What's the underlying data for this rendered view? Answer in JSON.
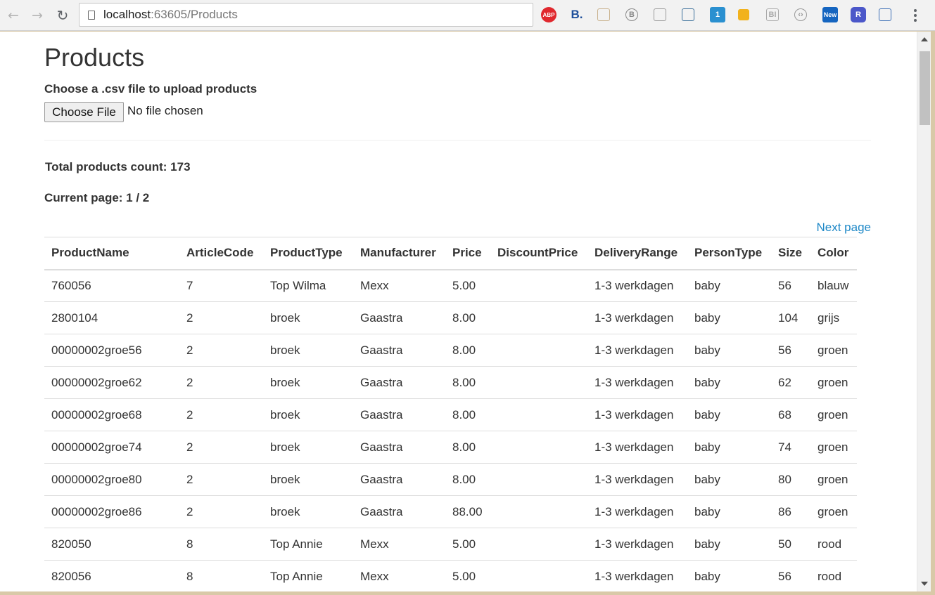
{
  "browser": {
    "url_host": "localhost",
    "url_rest": ":63605/Products",
    "extensions": [
      {
        "name": "adblock-plus-icon",
        "text": "ABP",
        "color": "#e0282e"
      },
      {
        "name": "b-extension-icon",
        "text": "B.",
        "color": "#1d4f9b"
      },
      {
        "name": "avatar-extension-icon",
        "text": "",
        "color": "#c8b08a"
      },
      {
        "name": "circle-b-extension-icon",
        "text": "B",
        "color": "#888888"
      },
      {
        "name": "document-extension-icon",
        "text": "",
        "color": "#9a9a9a"
      },
      {
        "name": "bug-extension-icon",
        "text": "",
        "color": "#3a6f9a"
      },
      {
        "name": "camera-extension-icon",
        "text": "1",
        "color": "#2a90d0"
      },
      {
        "name": "puzzle-extension-icon",
        "text": "",
        "color": "#f2b21c"
      },
      {
        "name": "bi-extension-icon",
        "text": "BI",
        "color": "#aaaaaa"
      },
      {
        "name": "code-extension-icon",
        "text": "‹›",
        "color": "#999999"
      },
      {
        "name": "new-extension-icon",
        "text": "New",
        "color": "#1565c0"
      },
      {
        "name": "r-extension-icon",
        "text": "R",
        "color": "#4b57c9"
      },
      {
        "name": "dots-extension-icon",
        "text": "",
        "color": "#3d6fb6"
      }
    ]
  },
  "page": {
    "title": "Products",
    "upload_label": "Choose a .csv file to upload products",
    "choose_file_button": "Choose File",
    "no_file_text": "No file chosen",
    "total_count": "Total products count: 173",
    "current_page": "Current page: 1 / 2",
    "next_page_link": "Next page"
  },
  "table": {
    "headers": [
      "ProductName",
      "ArticleCode",
      "ProductType",
      "Manufacturer",
      "Price",
      "DiscountPrice",
      "DeliveryRange",
      "PersonType",
      "Size",
      "Color"
    ],
    "rows": [
      [
        "760056",
        "7",
        "Top Wilma",
        "Mexx",
        "5.00",
        "",
        "1-3 werkdagen",
        "baby",
        "56",
        "blauw"
      ],
      [
        "2800104",
        "2",
        "broek",
        "Gaastra",
        "8.00",
        "",
        "1-3 werkdagen",
        "baby",
        "104",
        "grijs"
      ],
      [
        "00000002groe56",
        "2",
        "broek",
        "Gaastra",
        "8.00",
        "",
        "1-3 werkdagen",
        "baby",
        "56",
        "groen"
      ],
      [
        "00000002groe62",
        "2",
        "broek",
        "Gaastra",
        "8.00",
        "",
        "1-3 werkdagen",
        "baby",
        "62",
        "groen"
      ],
      [
        "00000002groe68",
        "2",
        "broek",
        "Gaastra",
        "8.00",
        "",
        "1-3 werkdagen",
        "baby",
        "68",
        "groen"
      ],
      [
        "00000002groe74",
        "2",
        "broek",
        "Gaastra",
        "8.00",
        "",
        "1-3 werkdagen",
        "baby",
        "74",
        "groen"
      ],
      [
        "00000002groe80",
        "2",
        "broek",
        "Gaastra",
        "8.00",
        "",
        "1-3 werkdagen",
        "baby",
        "80",
        "groen"
      ],
      [
        "00000002groe86",
        "2",
        "broek",
        "Gaastra",
        "88.00",
        "",
        "1-3 werkdagen",
        "baby",
        "86",
        "groen"
      ],
      [
        "820050",
        "8",
        "Top Annie",
        "Mexx",
        "5.00",
        "",
        "1-3 werkdagen",
        "baby",
        "50",
        "rood"
      ],
      [
        "820056",
        "8",
        "Top Annie",
        "Mexx",
        "5.00",
        "",
        "1-3 werkdagen",
        "baby",
        "56",
        "rood"
      ]
    ]
  }
}
